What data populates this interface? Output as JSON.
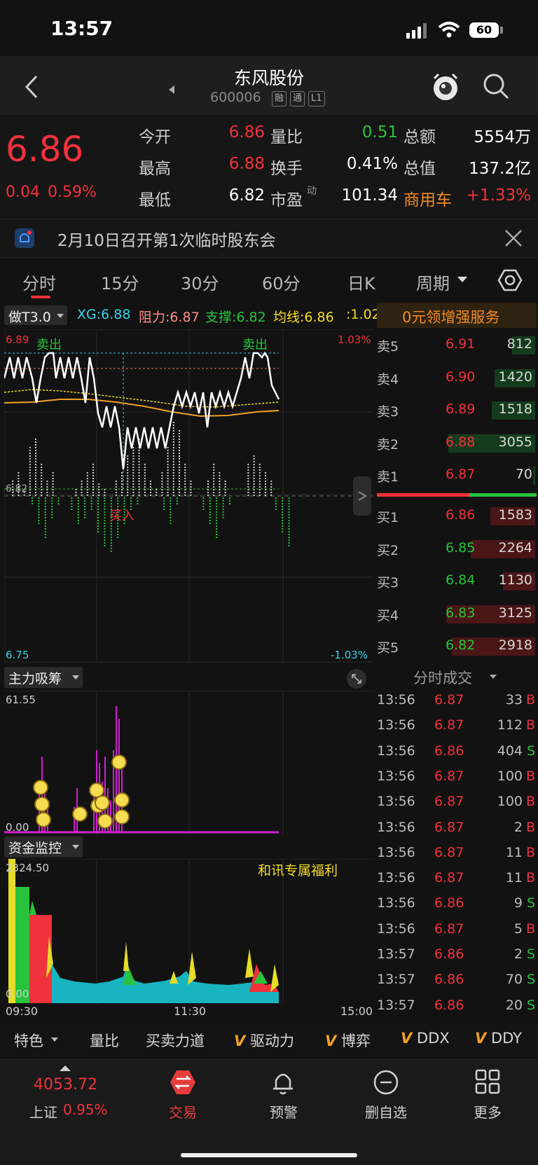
{
  "status_bar": {
    "time": "13:57",
    "battery": "60"
  },
  "header": {
    "title": "东风股份",
    "code": "600006",
    "tags": [
      "融",
      "通",
      "L1"
    ]
  },
  "quote": {
    "price": "6.86",
    "change": "0.04",
    "change_pct": "0.59%",
    "rows": [
      {
        "l1": "今开",
        "v1": "6.86",
        "l2": "量比",
        "v2": "0.51",
        "l3": "总额",
        "v3": "5554万"
      },
      {
        "l1": "最高",
        "v1": "6.88",
        "l2": "换手",
        "v2": "0.41%",
        "l3": "总值",
        "v3": "137.2亿"
      },
      {
        "l1": "最低",
        "v1": "6.82",
        "l2": "市盈",
        "l2_sup": "动",
        "v2": "101.34",
        "l3": "商用车",
        "v3": "+1.33%"
      }
    ]
  },
  "notice": {
    "text": "2月10日召开第1次临时股东会"
  },
  "tabs": [
    "分时",
    "15分",
    "30分",
    "60分",
    "日K",
    "周期"
  ],
  "chart": {
    "indicator_select": "做T3.0",
    "xg": "XG:6.88",
    "resistance": "阻力:6.87",
    "support": "支撑:6.82",
    "avg": "均线:6.86",
    "extra": ":1.02",
    "promo": "0元领增强服务",
    "high_price": "6.89",
    "high_pct": "1.03%",
    "low_price": "6.75",
    "low_pct": "-1.03%",
    "sell_signal": "卖出",
    "buy_signal": "买入",
    "mid_label": "6.82"
  },
  "order_book": {
    "asks": [
      {
        "label": "卖5",
        "price": "6.91",
        "vol": "812"
      },
      {
        "label": "卖4",
        "price": "6.90",
        "vol": "1420"
      },
      {
        "label": "卖3",
        "price": "6.89",
        "vol": "1518"
      },
      {
        "label": "卖2",
        "price": "6.88",
        "vol": "3055"
      },
      {
        "label": "卖1",
        "price": "6.87",
        "vol": "70"
      }
    ],
    "bids": [
      {
        "label": "买1",
        "price": "6.86",
        "vol": "1583"
      },
      {
        "label": "买2",
        "price": "6.85",
        "vol": "2264"
      },
      {
        "label": "买3",
        "price": "6.84",
        "vol": "1130"
      },
      {
        "label": "买4",
        "price": "6.83",
        "vol": "3125"
      },
      {
        "label": "买5",
        "price": "6.82",
        "vol": "2918"
      }
    ]
  },
  "sub1": {
    "title": "主力吸筹",
    "max": "61.55",
    "min": "0.00"
  },
  "sub2": {
    "title": "资金监控",
    "max": "2324.50",
    "min": "0.00",
    "promo": "和讯专属福利",
    "x_start": "09:30",
    "x_mid": "11:30",
    "x_end": "15:00"
  },
  "trades_header": "分时成交",
  "trades": [
    {
      "time": "13:56",
      "price": "6.87",
      "vol": "33",
      "side": "B"
    },
    {
      "time": "13:56",
      "price": "6.87",
      "vol": "112",
      "side": "B"
    },
    {
      "time": "13:56",
      "price": "6.86",
      "vol": "404",
      "side": "S"
    },
    {
      "time": "13:56",
      "price": "6.87",
      "vol": "100",
      "side": "B"
    },
    {
      "time": "13:56",
      "price": "6.87",
      "vol": "100",
      "side": "B"
    },
    {
      "time": "13:56",
      "price": "6.87",
      "vol": "2",
      "side": "B"
    },
    {
      "time": "13:56",
      "price": "6.87",
      "vol": "11",
      "side": "B"
    },
    {
      "time": "13:56",
      "price": "6.87",
      "vol": "11",
      "side": "B"
    },
    {
      "time": "13:56",
      "price": "6.86",
      "vol": "9",
      "side": "S"
    },
    {
      "time": "13:56",
      "price": "6.87",
      "vol": "5",
      "side": "B"
    },
    {
      "time": "13:57",
      "price": "6.86",
      "vol": "2",
      "side": "S"
    },
    {
      "time": "13:57",
      "price": "6.86",
      "vol": "70",
      "side": "S"
    },
    {
      "time": "13:57",
      "price": "6.86",
      "vol": "20",
      "side": "S"
    }
  ],
  "indicators": {
    "special": "特色",
    "items": [
      "量比",
      "买卖力道",
      "驱动力",
      "博弈",
      "DDX",
      "DDY"
    ],
    "v_mark": "V"
  },
  "bottom_nav": {
    "index_value": "4053.72",
    "index_name": "上证",
    "index_pct": "0.95%",
    "items": [
      "交易",
      "预警",
      "删自选",
      "更多"
    ]
  },
  "colors": {
    "up": "#f0323c",
    "down": "#27c33c",
    "accent": "#f08c28"
  }
}
